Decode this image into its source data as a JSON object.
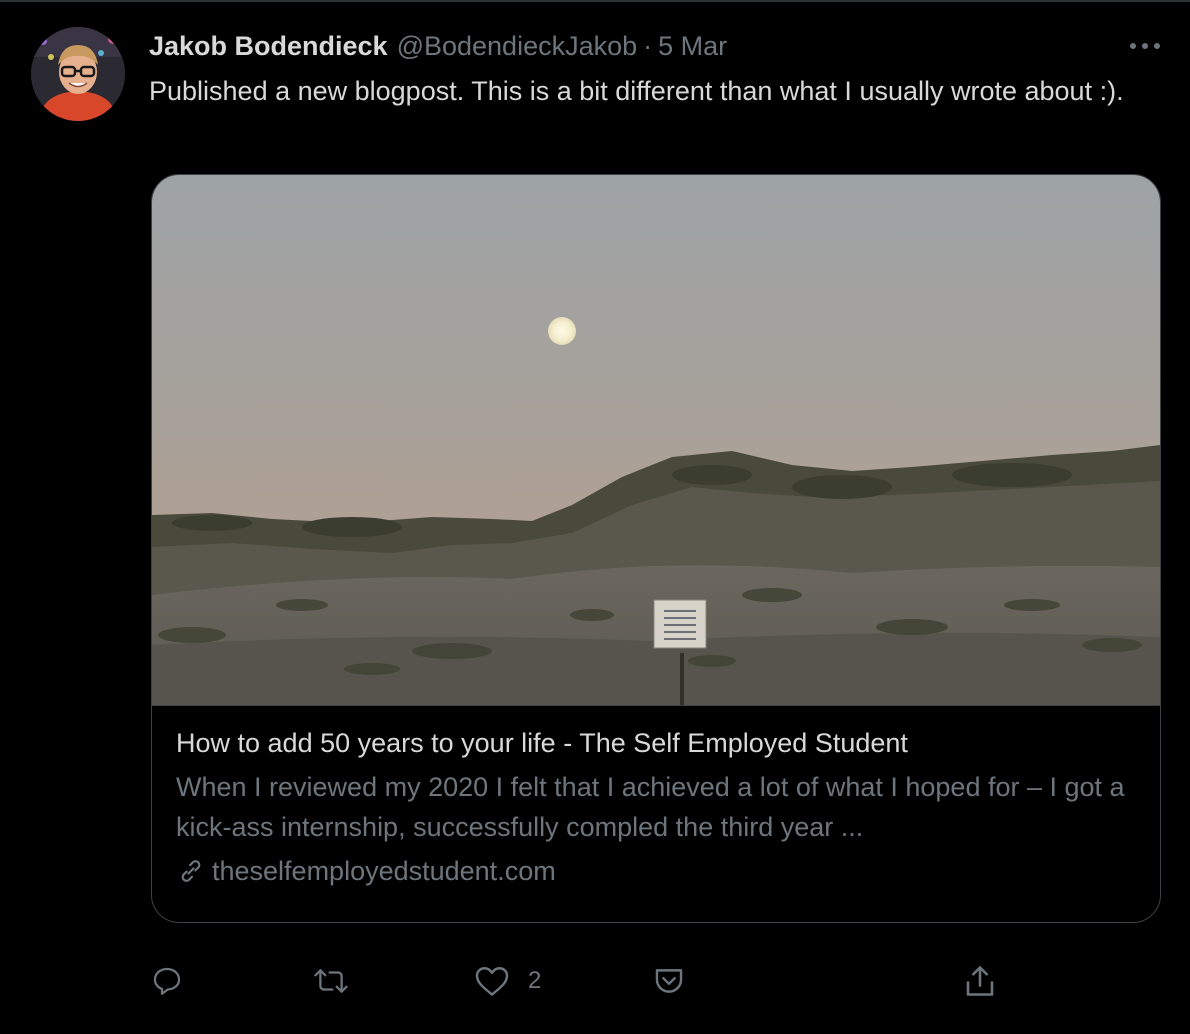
{
  "tweet": {
    "author_name": "Jakob Bodendieck",
    "author_handle": "@BodendieckJakob",
    "separator": "·",
    "date": "5 Mar",
    "text": "Published a new blogpost. This is a bit different than what I usually wrote about :).",
    "more_icon": "more-horizontal-icon"
  },
  "card": {
    "title": "How to add 50 years to your life - The Self Employed Student",
    "description": "When I reviewed my 2020 I felt that I achieved a lot of what I hoped for – I got a kick-ass internship, successfully compled the third year ...",
    "domain": "theselfemployedstudent.com",
    "link_icon": "link-icon"
  },
  "actions": {
    "reply_icon": "reply-icon",
    "retweet_icon": "retweet-icon",
    "like_icon": "heart-icon",
    "like_count": "2",
    "save_icon": "pocket-icon",
    "share_icon": "share-icon"
  },
  "colors": {
    "background": "#000000",
    "primary_text": "#d9d9d9",
    "secondary_text": "#6e767d",
    "border": "#3d4246"
  }
}
